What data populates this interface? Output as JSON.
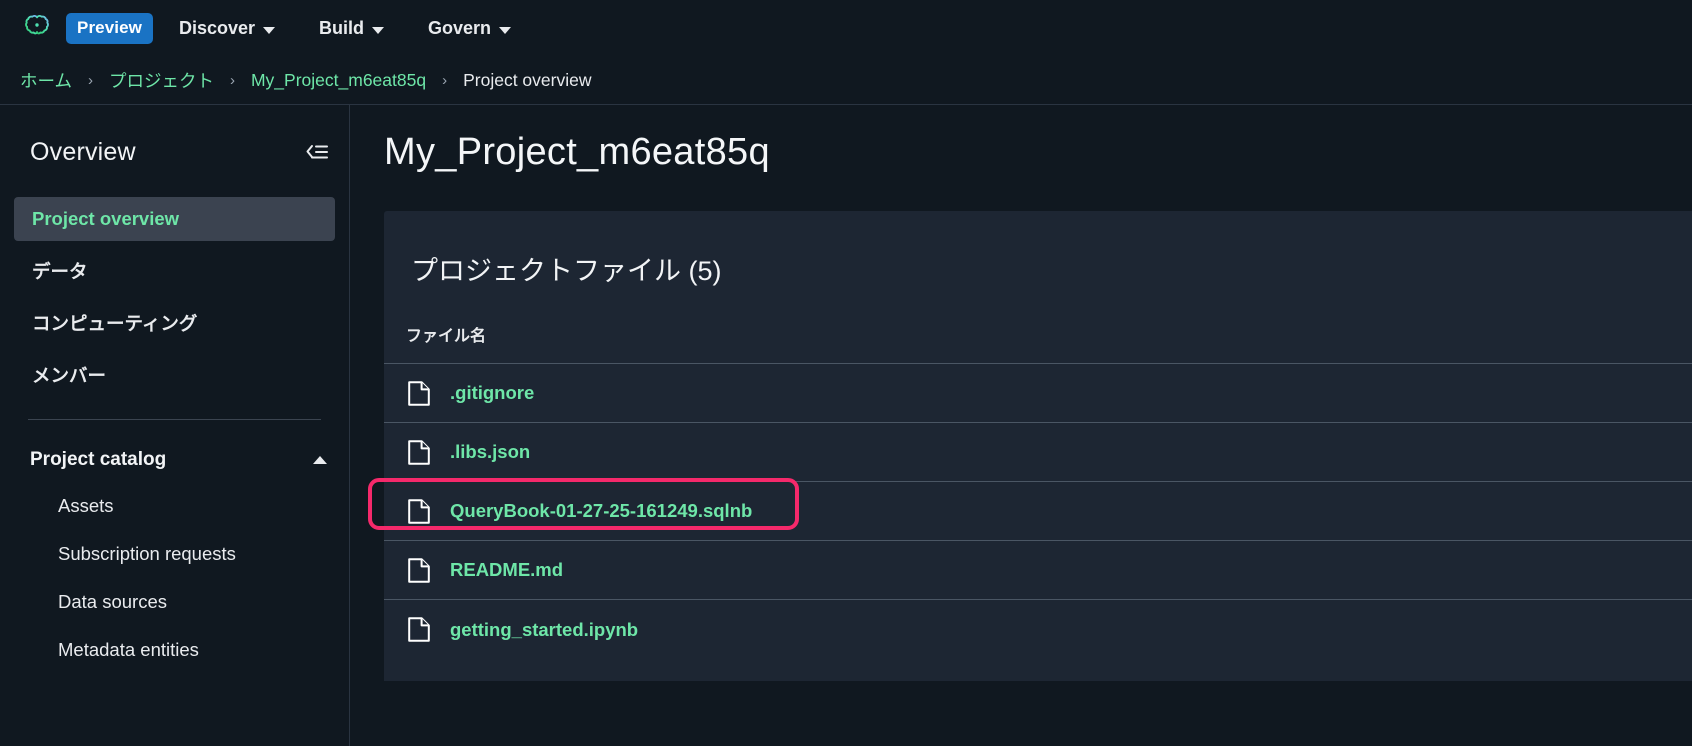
{
  "colors": {
    "accent_green": "#6ee6a8",
    "preview_badge_bg": "#1a73c4",
    "highlight_border": "#f5296b",
    "panel_bg": "#1d2633",
    "page_bg": "#101820",
    "sidebar_active_bg": "#3b4350"
  },
  "topnav": {
    "logo_icon": "brain-icon",
    "preview_badge": "Preview",
    "items": [
      {
        "label": "Discover",
        "icon": "chevron-down-icon"
      },
      {
        "label": "Build",
        "icon": "chevron-down-icon"
      },
      {
        "label": "Govern",
        "icon": "chevron-down-icon"
      }
    ]
  },
  "breadcrumb": {
    "separator": "›",
    "items": [
      {
        "label": "ホーム",
        "current": false
      },
      {
        "label": "プロジェクト",
        "current": false
      },
      {
        "label": "My_Project_m6eat85q",
        "current": false
      },
      {
        "label": "Project overview",
        "current": true
      }
    ]
  },
  "sidebar": {
    "title": "Overview",
    "collapse_icon": "collapse-panel-icon",
    "items": [
      {
        "label": "Project overview",
        "active": true
      },
      {
        "label": "データ",
        "active": false
      },
      {
        "label": "コンピューティング",
        "active": false
      },
      {
        "label": "メンバー",
        "active": false
      }
    ],
    "group": {
      "title": "Project catalog",
      "expand_icon": "chevron-up-icon",
      "expanded": true,
      "items": [
        {
          "label": "Assets"
        },
        {
          "label": "Subscription requests"
        },
        {
          "label": "Data sources"
        },
        {
          "label": "Metadata entities"
        }
      ]
    }
  },
  "main": {
    "page_title": "My_Project_m6eat85q",
    "panel": {
      "title": "プロジェクトファイル (5)",
      "column_header": "ファイル名",
      "files": [
        {
          "name": ".gitignore",
          "icon": "file-icon",
          "highlighted": false
        },
        {
          "name": ".libs.json",
          "icon": "file-icon",
          "highlighted": false
        },
        {
          "name": "QueryBook-01-27-25-161249.sqlnb",
          "icon": "file-icon",
          "highlighted": true
        },
        {
          "name": "README.md",
          "icon": "file-icon",
          "highlighted": false
        },
        {
          "name": "getting_started.ipynb",
          "icon": "file-icon",
          "highlighted": false
        }
      ]
    }
  }
}
